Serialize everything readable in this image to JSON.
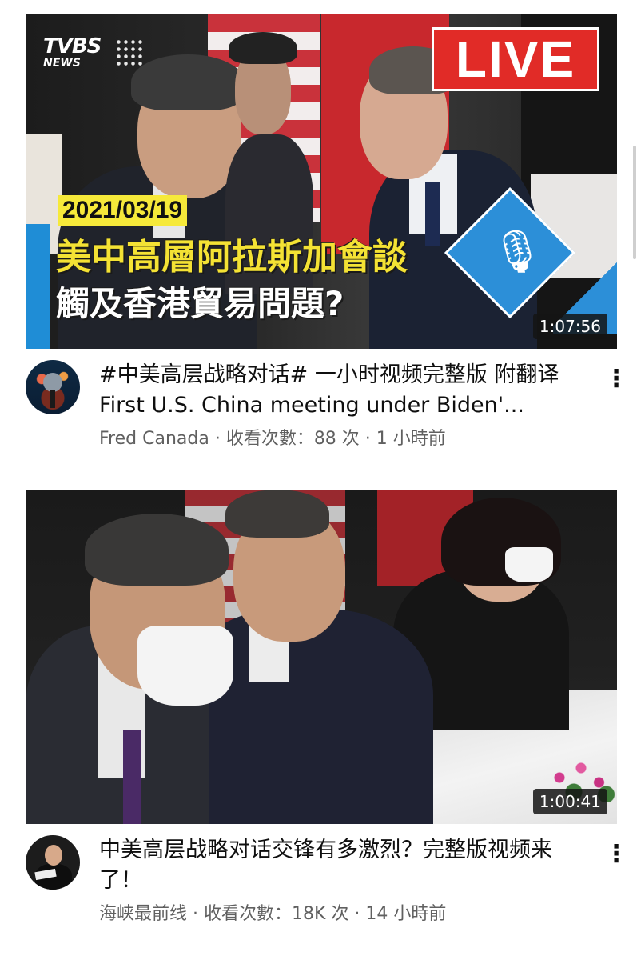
{
  "videos": [
    {
      "thumbnail": {
        "logo_main": "TVBS",
        "logo_sub": "NEWS",
        "live_badge": "LIVE",
        "date": "2021/03/19",
        "headline_line1": "美中高層阿拉斯加會談",
        "headline_line2": "觸及香港貿易問題?",
        "mic_icon": "microphone-icon",
        "duration": "1:07:56"
      },
      "title": "#中美高层战略对话# 一小时视频完整版 附翻译 First U.S. China meeting under Biden'...",
      "channel": "Fred Canada",
      "separator1": " · ",
      "views": "收看次數：88 次",
      "separator2": " · ",
      "age": "1 小時前",
      "menu_icon": "⋮"
    },
    {
      "thumbnail": {
        "duration": "1:00:41"
      },
      "title": "中美高层战略对话交锋有多激烈？完整版视频来了！",
      "channel": "海峡最前线",
      "separator1": " · ",
      "views": "收看次數：18K 次",
      "separator2": " · ",
      "age": "14 小時前",
      "menu_icon": "⋮"
    }
  ],
  "colors": {
    "live_red": "#e12b27",
    "headline_yellow": "#f4e234",
    "date_yellow": "#f6e93a",
    "accent_blue": "#2c8fd8",
    "meta_gray": "#606060"
  }
}
